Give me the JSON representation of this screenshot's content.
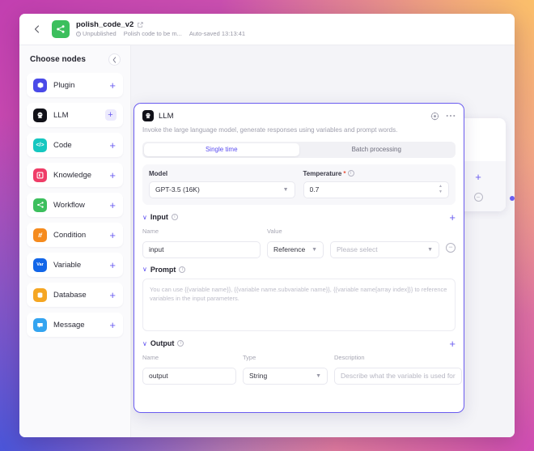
{
  "topbar": {
    "back_icon": "chevron-left-icon",
    "app_icon": "workflow-share-icon",
    "project_name": "polish_code_v2",
    "edit_icon": "edit-square-icon",
    "status": "Unpublished",
    "description": "Polish code to be m...",
    "autosave": "Auto-saved 13:13:41"
  },
  "sidebar": {
    "title": "Choose nodes",
    "collapse_icon": "chevron-left-icon",
    "items": [
      {
        "label": "Plugin",
        "icon": "plugin-icon",
        "color": "#4a4ae8",
        "glyph": "⚒",
        "add": "+"
      },
      {
        "label": "LLM",
        "icon": "llm-icon",
        "color": "#111118",
        "glyph": "●",
        "add": "+"
      },
      {
        "label": "Code",
        "icon": "code-icon",
        "color": "#15c7c0",
        "glyph": "</>",
        "add": "+"
      },
      {
        "label": "Knowledge",
        "icon": "knowledge-icon",
        "color": "#ef3d68",
        "glyph": "▣",
        "add": "+"
      },
      {
        "label": "Workflow",
        "icon": "workflow-icon",
        "color": "#3cbf5d",
        "glyph": "∴",
        "add": "+"
      },
      {
        "label": "Condition",
        "icon": "condition-icon",
        "color": "#f58b1e",
        "glyph": "If",
        "add": "+"
      },
      {
        "label": "Variable",
        "icon": "variable-icon",
        "color": "#1266e8",
        "glyph": "Var",
        "add": "+"
      },
      {
        "label": "Database",
        "icon": "database-icon",
        "color": "#f5a623",
        "glyph": "⌸",
        "add": "+"
      },
      {
        "label": "Message",
        "icon": "message-icon",
        "color": "#34a4f0",
        "glyph": "●",
        "add": "+"
      }
    ]
  },
  "panel": {
    "node_icon": "llm-icon",
    "title": "LLM",
    "pin_icon": "target-pin-icon",
    "more_icon": "ellipsis-icon",
    "description": "Invoke the large language model, generate responses using variables and prompt words.",
    "tabs": [
      {
        "label": "Single time",
        "active": true
      },
      {
        "label": "Batch processing",
        "active": false
      }
    ],
    "model": {
      "label": "Model",
      "value": "GPT-3.5 (16K)",
      "chevron": "chevron-down-icon"
    },
    "temperature": {
      "label": "Temperature",
      "required_mark": "*",
      "info_icon": "info-icon",
      "value": "0.7"
    },
    "input_section": {
      "caret": "∨",
      "title": "Input",
      "info_icon": "info-icon",
      "add": "+",
      "columns": [
        "Name",
        "Value"
      ],
      "rows": [
        {
          "name": "input",
          "ref_type": "Reference",
          "value_placeholder": "Please select",
          "remove": "−"
        }
      ]
    },
    "prompt_section": {
      "caret": "∨",
      "title": "Prompt",
      "info_icon": "info-icon",
      "placeholder": "You can use {{variable name}},  {{variable name.subvariable name}},  {{variable name[array index]}} to reference variables in the input parameters."
    },
    "output_section": {
      "caret": "∨",
      "title": "Output",
      "info_icon": "info-icon",
      "add": "+",
      "columns": [
        "Name",
        "Type",
        "Description"
      ],
      "rows": [
        {
          "name": "output",
          "type": "String",
          "desc_placeholder": "Describe what the variable is used for",
          "remove": "−"
        }
      ]
    }
  },
  "canvas": {
    "ghost_node": {
      "add": "+",
      "collapse": "−"
    }
  },
  "colors": {
    "accent": "#6a5cf0",
    "accent_text": "#5a4cf0",
    "required": "#e8543f",
    "panel_bg": "#ffffff",
    "canvas_bg": "#f4f4f8"
  }
}
